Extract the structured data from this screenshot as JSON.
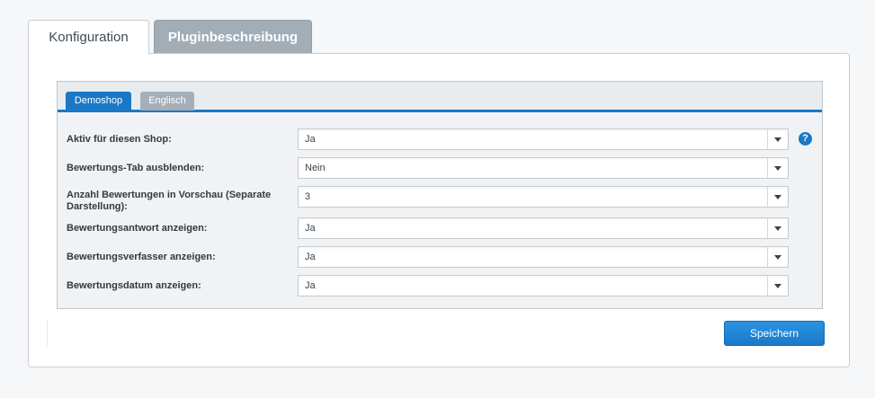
{
  "outer_tabs": [
    {
      "label": "Konfiguration",
      "active": true
    },
    {
      "label": "Pluginbeschreibung",
      "active": false
    }
  ],
  "shop_tabs": [
    {
      "label": "Demoshop",
      "active": true
    },
    {
      "label": "Englisch",
      "active": false
    }
  ],
  "fields": [
    {
      "label": "Aktiv für diesen Shop:",
      "value": "Ja"
    },
    {
      "label": "Bewertungs-Tab ausblenden:",
      "value": "Nein"
    },
    {
      "label": "Anzahl Bewertungen in Vorschau (Separate Darstellung):",
      "value": "3"
    },
    {
      "label": "Bewertungsantwort anzeigen:",
      "value": "Ja"
    },
    {
      "label": "Bewertungsverfasser anzeigen:",
      "value": "Ja"
    },
    {
      "label": "Bewertungsdatum anzeigen:",
      "value": "Ja"
    }
  ],
  "help_icon": {
    "glyph": "?",
    "icon": "question-icon"
  },
  "save_button_label": "Speichern",
  "colors": {
    "accent": "#1a79c7",
    "inactive_tab": "#a2adb6"
  }
}
